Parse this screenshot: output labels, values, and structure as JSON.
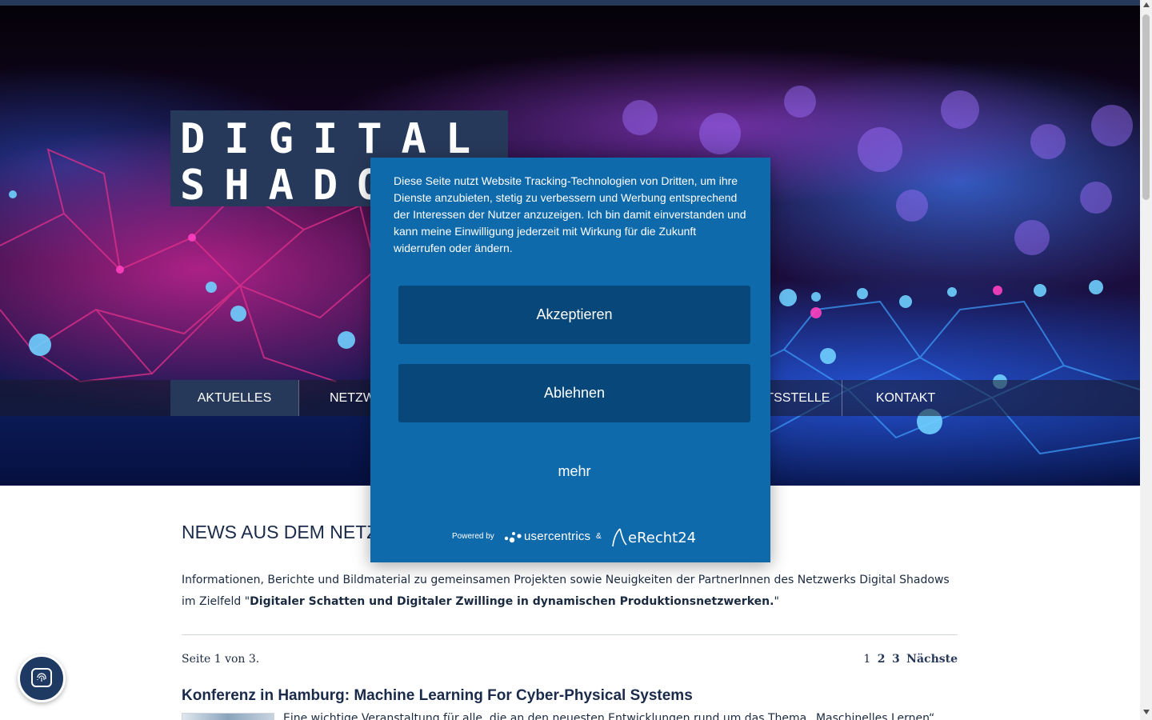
{
  "logo": {
    "line1": "DIGITAL",
    "line2": "SHADOWS"
  },
  "nav": {
    "items": [
      {
        "label": "AKTUELLES",
        "active": true
      },
      {
        "label": "NETZWERK",
        "active": false
      },
      {
        "label": "GESCHÄFTSSTELLE",
        "active": false
      },
      {
        "label": "KONTAKT",
        "active": false
      }
    ]
  },
  "main": {
    "title": "NEWS AUS DEM NETZWERK",
    "intro_plain": "Informationen, Berichte und Bildmaterial zu gemeinsamen Projekten sowie Neuigkeiten der PartnerInnen des Netzwerks Digital Shadows im Zielfeld \"",
    "intro_bold": "Digitaler Schatten und Digitaler Zwillinge in dynamischen Produktionsnetzwerken.",
    "intro_end": "\"",
    "page_info": "Seite 1 von 3.",
    "pagination": {
      "current": "1",
      "p2": "2",
      "p3": "3",
      "next": "Nächste"
    },
    "article": {
      "title": "Konferenz in Hamburg: Machine Learning For Cyber-Physical Systems",
      "excerpt": "Eine wichtige Veranstaltung für alle, die an den neuesten Entwicklungen rund um das Thema „Maschinelles Lernen“"
    }
  },
  "consent": {
    "text": "Diese Seite nutzt Website Tracking-Technologien von Dritten, um ihre Dienste anzubieten, stetig zu verbessern und Werbung entsprechend der Interessen der Nutzer anzuzeigen. Ich bin damit einverstanden und kann meine Einwilligung jederzeit mit Wirkung für die Zukunft widerrufen oder ändern.",
    "accept": "Akzeptieren",
    "deny": "Ablehnen",
    "more": "mehr",
    "powered_by": "Powered by",
    "usercentrics": "usercentrics",
    "amp": "&",
    "erecht": "eRecht24"
  },
  "colors": {
    "brand_navy": "#27395a",
    "consent_blue": "#0f6aab",
    "consent_button": "#07477a"
  },
  "icons": {
    "privacy": "fingerprint-chat-icon"
  }
}
